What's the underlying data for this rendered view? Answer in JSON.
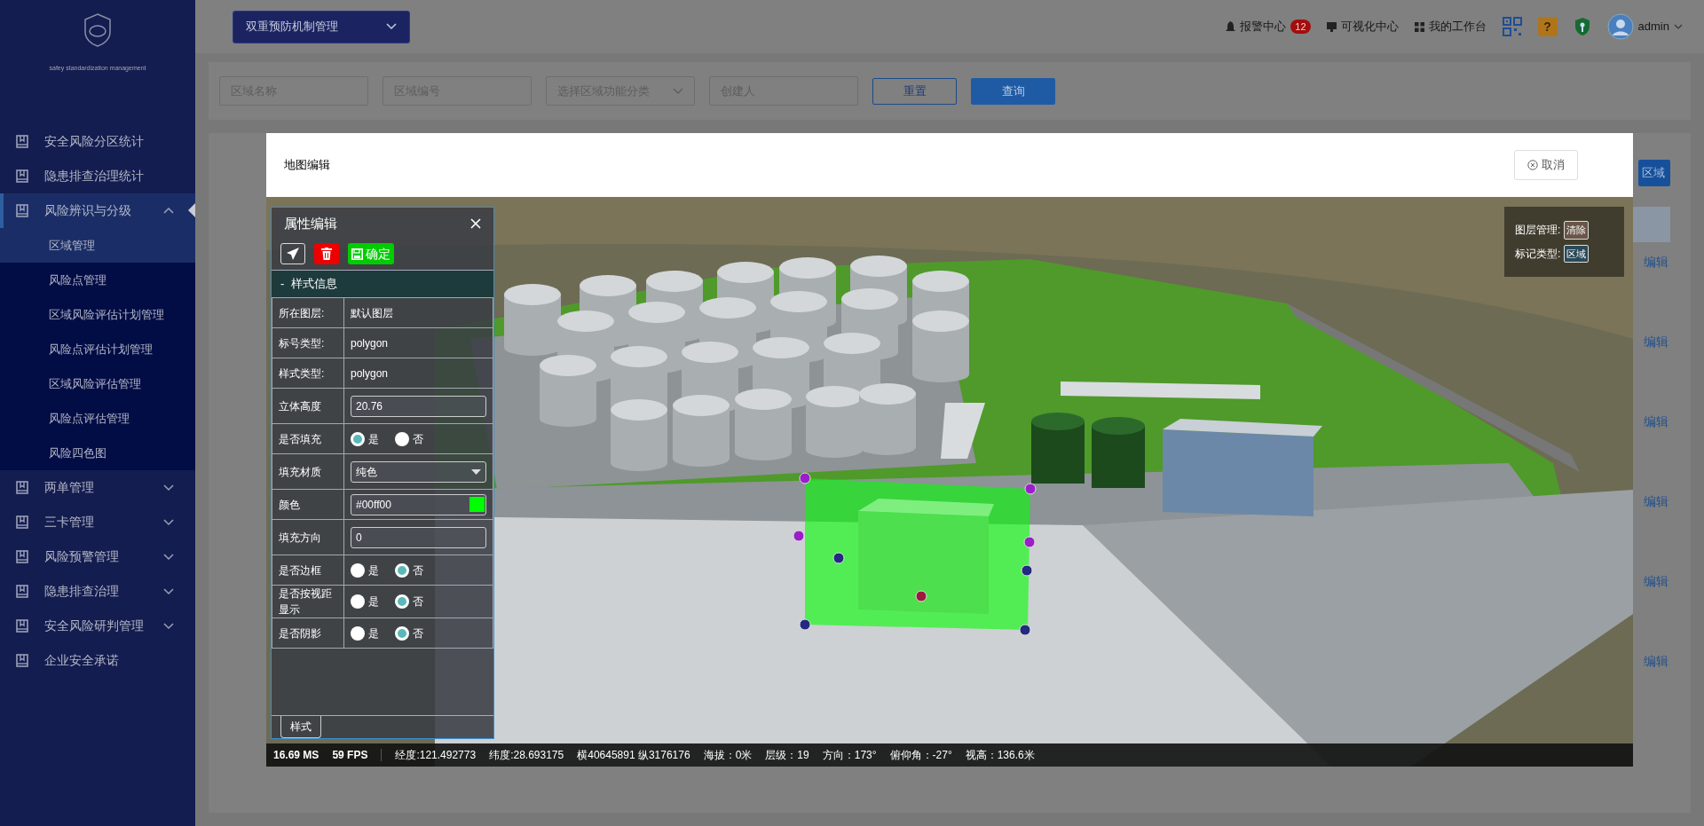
{
  "sidebar": {
    "brand": "safey standardization management",
    "items": [
      {
        "label": "安全风险分区统计",
        "selected": false
      },
      {
        "label": "隐患排查治理统计",
        "selected": false
      },
      {
        "label": "风险辨识与分级",
        "selected": true,
        "expanded": true,
        "children": [
          {
            "label": "区域管理",
            "selected": true
          },
          {
            "label": "风险点管理",
            "selected": false
          },
          {
            "label": "区域风险评估计划管理",
            "selected": false
          },
          {
            "label": "风险点评估计划管理",
            "selected": false
          },
          {
            "label": "区域风险评估管理",
            "selected": false
          },
          {
            "label": "风险点评估管理",
            "selected": false
          },
          {
            "label": "风险四色图",
            "selected": false
          }
        ]
      },
      {
        "label": "两单管理",
        "selected": false,
        "expanded": false
      },
      {
        "label": "三卡管理",
        "selected": false,
        "expanded": false
      },
      {
        "label": "风险预警管理",
        "selected": false,
        "expanded": false
      },
      {
        "label": "隐患排查治理",
        "selected": false,
        "expanded": false
      },
      {
        "label": "安全风险研判管理",
        "selected": false,
        "expanded": false
      },
      {
        "label": "企业安全承诺",
        "selected": false
      }
    ]
  },
  "header": {
    "system_menu": "双重预防机制管理",
    "alarm": {
      "label": "报警中心",
      "count": "12"
    },
    "links": [
      {
        "kind": "monitor",
        "label": "可视化中心"
      },
      {
        "kind": "grid",
        "label": "我的工作台"
      }
    ],
    "help_icon": "?",
    "user": "admin"
  },
  "filters": {
    "fields": [
      {
        "kind": "input",
        "placeholder": "区域名称"
      },
      {
        "kind": "input",
        "placeholder": "区域编号"
      },
      {
        "kind": "select",
        "placeholder": "选择区域功能分类"
      },
      {
        "kind": "input",
        "placeholder": "创建人"
      }
    ],
    "reset": "重置",
    "search": "查询"
  },
  "background_table": {
    "add_button": "区域",
    "row_actions": [
      "编辑",
      "编辑",
      "编辑",
      "编辑",
      "编辑",
      "编辑"
    ]
  },
  "modal": {
    "title": "地图编辑",
    "cancel": "取消",
    "property_panel": {
      "title": "属性编辑",
      "confirm": "确定",
      "section_toggle": "-",
      "section": "样式信息",
      "rows": [
        {
          "kind": "text",
          "label": "所在图层:",
          "value": "默认图层"
        },
        {
          "kind": "text",
          "label": "标号类型:",
          "value": "polygon"
        },
        {
          "kind": "text",
          "label": "样式类型:",
          "value": "polygon"
        },
        {
          "kind": "input",
          "label": "立体高度",
          "value": "20.76"
        },
        {
          "kind": "radio",
          "label": "是否填充",
          "options": [
            {
              "label": "是",
              "selected": true
            },
            {
              "label": "否",
              "selected": false
            }
          ]
        },
        {
          "kind": "select",
          "label": "填充材质",
          "value": "纯色"
        },
        {
          "kind": "color",
          "label": "颜色",
          "value": "#00ff00"
        },
        {
          "kind": "input",
          "label": "填充方向",
          "value": "0"
        },
        {
          "kind": "radio",
          "label": "是否边框",
          "options": [
            {
              "label": "是",
              "selected": false
            },
            {
              "label": "否",
              "selected": true
            }
          ]
        },
        {
          "kind": "radio",
          "label": "是否按视距显示",
          "options": [
            {
              "label": "是",
              "selected": false
            },
            {
              "label": "否",
              "selected": true
            }
          ]
        },
        {
          "kind": "radio",
          "label": "是否阴影",
          "options": [
            {
              "label": "是",
              "selected": false
            },
            {
              "label": "否",
              "selected": true
            }
          ]
        }
      ],
      "tab": "样式"
    },
    "layer_box": [
      {
        "label": "图层管理:",
        "button": "清除",
        "kind": "clear"
      },
      {
        "label": "标记类型:",
        "button": "区域",
        "kind": "type"
      }
    ],
    "status_bar": {
      "perf": [
        "16.69 MS",
        "59 FPS"
      ],
      "items": [
        "经度:121.492773",
        "纬度:28.693175",
        "横40645891 纵3176176",
        "海拔：0米",
        "层级：19",
        "方向：173°",
        "俯仰角：-27°",
        "视高：136.6米"
      ]
    }
  }
}
